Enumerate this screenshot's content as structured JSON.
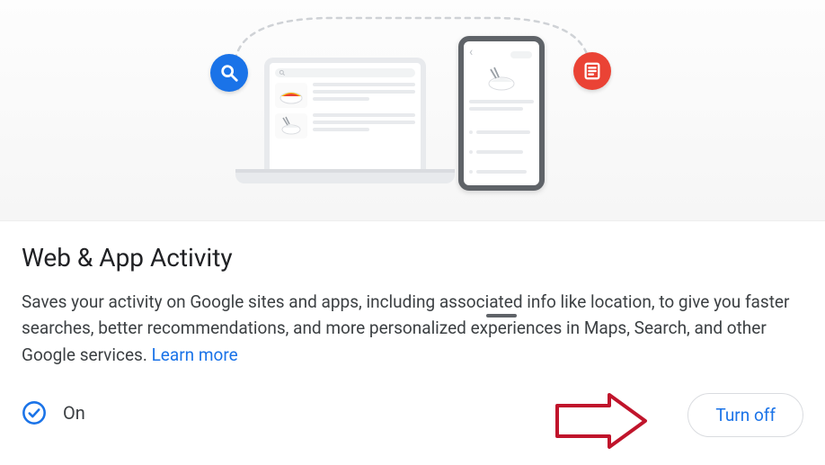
{
  "section": {
    "title": "Web & App Activity",
    "description": "Saves your activity on Google sites and apps, including associated info like location, to give you faster searches, better recommendations, and more personalized experiences in Maps, Search, and other Google services. ",
    "learn_more_label": "Learn more"
  },
  "status": {
    "label": "On"
  },
  "actions": {
    "turn_off_label": "Turn off"
  },
  "colors": {
    "accent_blue": "#1a73e8",
    "accent_red": "#ea4335"
  }
}
